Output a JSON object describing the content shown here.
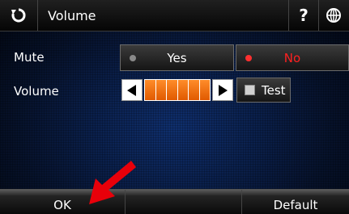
{
  "header": {
    "title": "Volume",
    "back_icon": "back-icon",
    "help_label": "?",
    "globe_icon": "globe-icon"
  },
  "mute": {
    "label": "Mute",
    "options": [
      {
        "label": "Yes",
        "selected": false
      },
      {
        "label": "No",
        "selected": true
      }
    ]
  },
  "volume": {
    "label": "Volume",
    "level_segments": 6,
    "test_label": "Test",
    "test_checked": false
  },
  "footer": {
    "ok_label": "OK",
    "default_label": "Default"
  },
  "colors": {
    "accent_orange": "#f07010",
    "selected_red": "#ff2020",
    "annotation_arrow": "#e8000a"
  }
}
